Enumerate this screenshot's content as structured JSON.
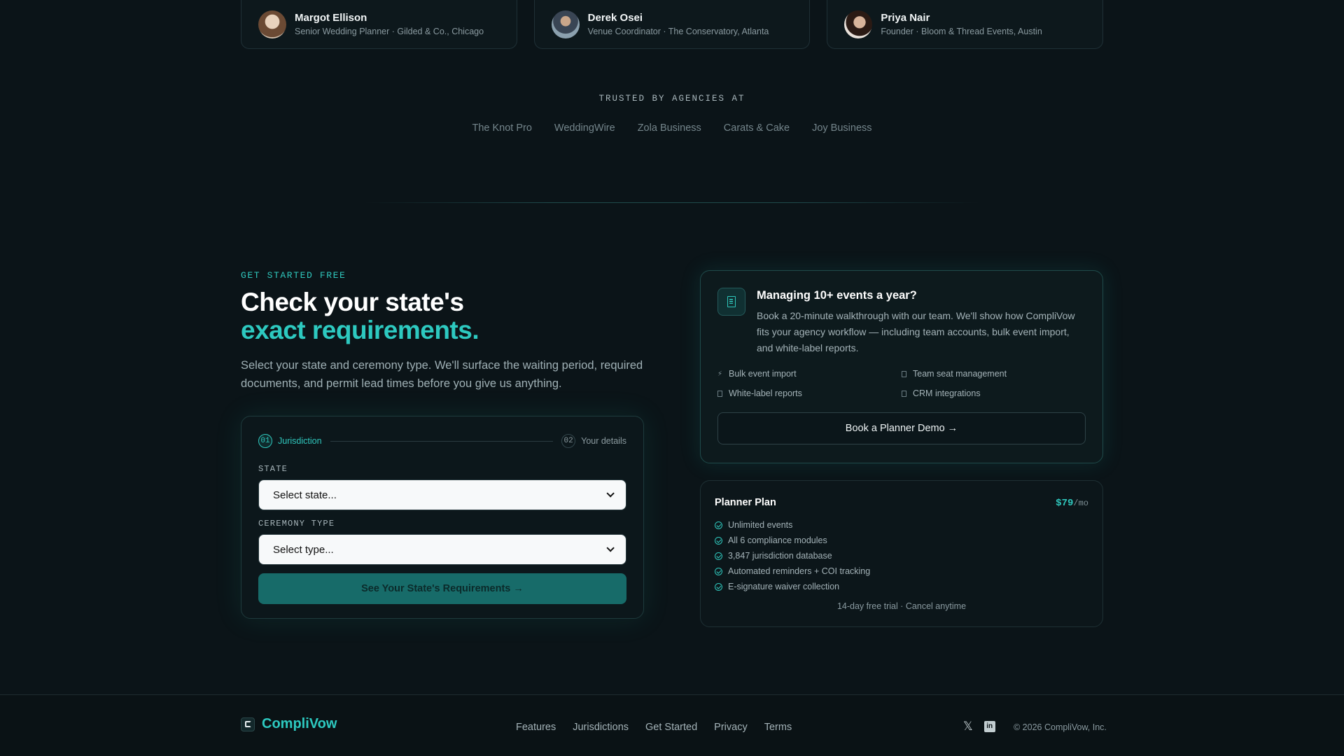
{
  "testimonials": [
    {
      "name": "Margot Ellison",
      "role": "Senior Wedding Planner · Gilded & Co., Chicago"
    },
    {
      "name": "Derek Osei",
      "role": "Venue Coordinator · The Conservatory, Atlanta"
    },
    {
      "name": "Priya Nair",
      "role": "Founder · Bloom & Thread Events, Austin"
    }
  ],
  "trusted": {
    "label": "TRUSTED BY AGENCIES AT",
    "logos": [
      "The Knot Pro",
      "WeddingWire",
      "Zola Business",
      "Carats & Cake",
      "Joy Business"
    ]
  },
  "get_started": {
    "eyebrow": "GET STARTED FREE",
    "headline_line1": "Check your state's",
    "headline_line2": "exact requirements.",
    "lead": "Select your state and ceremony type. We'll surface the waiting period, required documents, and permit lead times before you give us anything."
  },
  "form": {
    "step1_num": "01",
    "step1_label": "Jurisdiction",
    "step2_num": "02",
    "step2_label": "Your details",
    "state_label": "STATE",
    "state_value": "Select state...",
    "type_label": "CEREMONY TYPE",
    "type_value": "Select type...",
    "cta": "See Your State's Requirements →"
  },
  "demo": {
    "title": "Managing 10+ events a year?",
    "description": "Book a 20-minute walkthrough with our team. We'll show how CompliVow fits your agency workflow — including team accounts, bulk event import, and white-label reports.",
    "features": [
      "Bulk event import",
      "Team seat management",
      "White-label reports",
      "CRM integrations"
    ],
    "button": "Book a Planner Demo →"
  },
  "plan": {
    "title": "Planner Plan",
    "price": "$79",
    "period": "/mo",
    "items": [
      "Unlimited events",
      "All 6 compliance modules",
      "3,847 jurisdiction database",
      "Automated reminders + COI tracking",
      "E-signature waiver collection"
    ],
    "footnote": "14-day free trial · Cancel anytime"
  },
  "footer": {
    "brand": "CompliVow",
    "nav": [
      "Features",
      "Jurisdictions",
      "Get Started",
      "Privacy",
      "Terms"
    ],
    "copyright": "© 2026 CompliVow, Inc."
  },
  "colors": {
    "accent": "#2dc9c0",
    "background": "#0b1418",
    "cta": "#176b69"
  }
}
